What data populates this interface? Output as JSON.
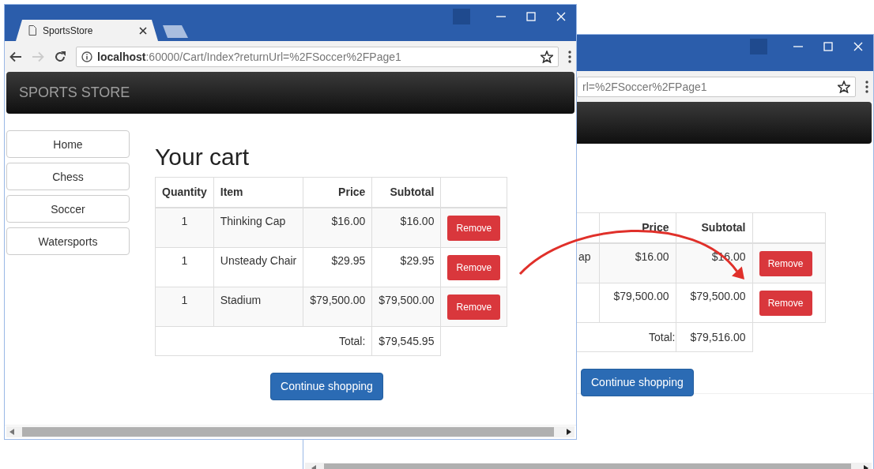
{
  "back_window": {
    "address": "rl=%2FSoccer%2FPage1",
    "table": {
      "columns": [
        "Price",
        "Subtotal"
      ],
      "rows": [
        {
          "item": "ap",
          "price": "$16.00",
          "subtotal": "$16.00",
          "action": "Remove"
        },
        {
          "price": "$79,500.00",
          "subtotal": "$79,500.00",
          "action": "Remove"
        }
      ],
      "total_label": "Total:",
      "total": "$79,516.00"
    },
    "continue_button": "Continue shopping"
  },
  "front_window": {
    "tab": {
      "title": "SportsStore"
    },
    "address": {
      "host": "localhost",
      "path": ":60000/Cart/Index?returnUrl=%2FSoccer%2FPage1"
    },
    "brand": "SPORTS STORE",
    "categories": [
      {
        "label": "Home"
      },
      {
        "label": "Chess"
      },
      {
        "label": "Soccer"
      },
      {
        "label": "Watersports"
      }
    ],
    "heading": "Your cart",
    "table": {
      "columns": [
        "Quantity",
        "Item",
        "Price",
        "Subtotal"
      ],
      "rows": [
        {
          "quantity": "1",
          "item": "Thinking Cap",
          "price": "$16.00",
          "subtotal": "$16.00",
          "action": "Remove"
        },
        {
          "quantity": "1",
          "item": "Unsteady Chair",
          "price": "$29.95",
          "subtotal": "$29.95",
          "action": "Remove"
        },
        {
          "quantity": "1",
          "item": "Stadium",
          "price": "$79,500.00",
          "subtotal": "$79,500.00",
          "action": "Remove"
        }
      ],
      "total_label": "Total:",
      "total": "$79,545.95"
    },
    "continue_button": "Continue shopping"
  }
}
